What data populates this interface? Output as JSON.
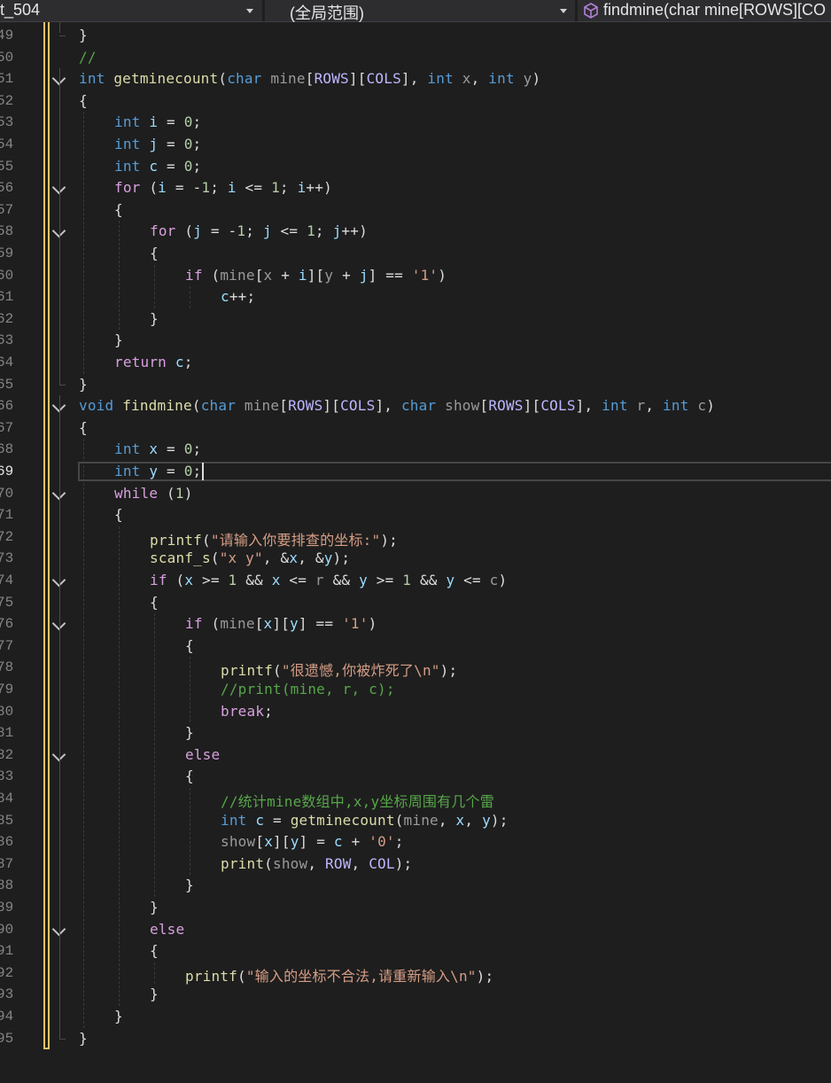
{
  "navbar": {
    "project": "t_504",
    "scope": "(全局范围)",
    "member": "findmine(char mine[ROWS][CO"
  },
  "colors": {
    "background": "#1e1e1e",
    "keyword": "#569cd6",
    "control": "#d8a0df",
    "function": "#dcdcaa",
    "string": "#d69d85",
    "comment": "#57a64a",
    "macro": "#beb7ff",
    "number": "#b5cea8",
    "parameter": "#9a9a9a",
    "local": "#9cdcfe",
    "change_bar": "#e5c365"
  },
  "editor": {
    "current_line": 69,
    "lines": [
      {
        "n": "49",
        "fold": false,
        "indent": 0,
        "tokens": [
          [
            "plain",
            "}"
          ]
        ]
      },
      {
        "n": "50",
        "fold": false,
        "indent": 0,
        "tokens": [
          [
            "cmt",
            "//"
          ]
        ]
      },
      {
        "n": "51",
        "fold": true,
        "indent": 0,
        "tokens": [
          [
            "kw",
            "int"
          ],
          [
            "plain",
            " "
          ],
          [
            "fn",
            "getminecount"
          ],
          [
            "plain",
            "("
          ],
          [
            "kw",
            "char"
          ],
          [
            "plain",
            " "
          ],
          [
            "prm",
            "mine"
          ],
          [
            "plain",
            "["
          ],
          [
            "mac",
            "ROWS"
          ],
          [
            "plain",
            "]["
          ],
          [
            "mac",
            "COLS"
          ],
          [
            "plain",
            "], "
          ],
          [
            "kw",
            "int"
          ],
          [
            "plain",
            " "
          ],
          [
            "prm",
            "x"
          ],
          [
            "plain",
            ", "
          ],
          [
            "kw",
            "int"
          ],
          [
            "plain",
            " "
          ],
          [
            "prm",
            "y"
          ],
          [
            "plain",
            ")"
          ]
        ]
      },
      {
        "n": "52",
        "fold": false,
        "indent": 0,
        "tokens": [
          [
            "plain",
            "{"
          ]
        ]
      },
      {
        "n": "53",
        "fold": false,
        "indent": 1,
        "tokens": [
          [
            "kw",
            "int"
          ],
          [
            "plain",
            " "
          ],
          [
            "var",
            "i"
          ],
          [
            "plain",
            " = "
          ],
          [
            "num",
            "0"
          ],
          [
            "plain",
            ";"
          ]
        ]
      },
      {
        "n": "54",
        "fold": false,
        "indent": 1,
        "tokens": [
          [
            "kw",
            "int"
          ],
          [
            "plain",
            " "
          ],
          [
            "var",
            "j"
          ],
          [
            "plain",
            " = "
          ],
          [
            "num",
            "0"
          ],
          [
            "plain",
            ";"
          ]
        ]
      },
      {
        "n": "55",
        "fold": false,
        "indent": 1,
        "tokens": [
          [
            "kw",
            "int"
          ],
          [
            "plain",
            " "
          ],
          [
            "var",
            "c"
          ],
          [
            "plain",
            " = "
          ],
          [
            "num",
            "0"
          ],
          [
            "plain",
            ";"
          ]
        ]
      },
      {
        "n": "56",
        "fold": true,
        "indent": 1,
        "tokens": [
          [
            "ctl",
            "for"
          ],
          [
            "plain",
            " ("
          ],
          [
            "var",
            "i"
          ],
          [
            "plain",
            " = -"
          ],
          [
            "num",
            "1"
          ],
          [
            "plain",
            "; "
          ],
          [
            "var",
            "i"
          ],
          [
            "plain",
            " <= "
          ],
          [
            "num",
            "1"
          ],
          [
            "plain",
            "; "
          ],
          [
            "var",
            "i"
          ],
          [
            "plain",
            "++)"
          ]
        ]
      },
      {
        "n": "57",
        "fold": false,
        "indent": 1,
        "tokens": [
          [
            "plain",
            "{"
          ]
        ]
      },
      {
        "n": "58",
        "fold": true,
        "indent": 2,
        "tokens": [
          [
            "ctl",
            "for"
          ],
          [
            "plain",
            " ("
          ],
          [
            "var",
            "j"
          ],
          [
            "plain",
            " = -"
          ],
          [
            "num",
            "1"
          ],
          [
            "plain",
            "; "
          ],
          [
            "var",
            "j"
          ],
          [
            "plain",
            " <= "
          ],
          [
            "num",
            "1"
          ],
          [
            "plain",
            "; "
          ],
          [
            "var",
            "j"
          ],
          [
            "plain",
            "++)"
          ]
        ]
      },
      {
        "n": "59",
        "fold": false,
        "indent": 2,
        "tokens": [
          [
            "plain",
            "{"
          ]
        ]
      },
      {
        "n": "60",
        "fold": false,
        "indent": 3,
        "tokens": [
          [
            "ctl",
            "if"
          ],
          [
            "plain",
            " ("
          ],
          [
            "prm",
            "mine"
          ],
          [
            "plain",
            "["
          ],
          [
            "prm",
            "x"
          ],
          [
            "plain",
            " + "
          ],
          [
            "var",
            "i"
          ],
          [
            "plain",
            "]["
          ],
          [
            "prm",
            "y"
          ],
          [
            "plain",
            " + "
          ],
          [
            "var",
            "j"
          ],
          [
            "plain",
            "] == "
          ],
          [
            "str",
            "'1'"
          ],
          [
            "plain",
            ")"
          ]
        ]
      },
      {
        "n": "61",
        "fold": false,
        "indent": 4,
        "tokens": [
          [
            "var",
            "c"
          ],
          [
            "plain",
            "++;"
          ]
        ]
      },
      {
        "n": "62",
        "fold": false,
        "indent": 2,
        "tokens": [
          [
            "plain",
            "}"
          ]
        ]
      },
      {
        "n": "63",
        "fold": false,
        "indent": 1,
        "tokens": [
          [
            "plain",
            "}"
          ]
        ]
      },
      {
        "n": "64",
        "fold": false,
        "indent": 1,
        "tokens": [
          [
            "ctl",
            "return"
          ],
          [
            "plain",
            " "
          ],
          [
            "var",
            "c"
          ],
          [
            "plain",
            ";"
          ]
        ]
      },
      {
        "n": "65",
        "fold": false,
        "indent": 0,
        "tokens": [
          [
            "plain",
            "}"
          ]
        ]
      },
      {
        "n": "66",
        "fold": true,
        "indent": 0,
        "tokens": [
          [
            "kw",
            "void"
          ],
          [
            "plain",
            " "
          ],
          [
            "fn",
            "findmine"
          ],
          [
            "plain",
            "("
          ],
          [
            "kw",
            "char"
          ],
          [
            "plain",
            " "
          ],
          [
            "prm",
            "mine"
          ],
          [
            "plain",
            "["
          ],
          [
            "mac",
            "ROWS"
          ],
          [
            "plain",
            "]["
          ],
          [
            "mac",
            "COLS"
          ],
          [
            "plain",
            "], "
          ],
          [
            "kw",
            "char"
          ],
          [
            "plain",
            " "
          ],
          [
            "prm",
            "show"
          ],
          [
            "plain",
            "["
          ],
          [
            "mac",
            "ROWS"
          ],
          [
            "plain",
            "]["
          ],
          [
            "mac",
            "COLS"
          ],
          [
            "plain",
            "], "
          ],
          [
            "kw",
            "int"
          ],
          [
            "plain",
            " "
          ],
          [
            "prm",
            "r"
          ],
          [
            "plain",
            ", "
          ],
          [
            "kw",
            "int"
          ],
          [
            "plain",
            " "
          ],
          [
            "prm",
            "c"
          ],
          [
            "plain",
            ")"
          ]
        ]
      },
      {
        "n": "67",
        "fold": false,
        "indent": 0,
        "tokens": [
          [
            "plain",
            "{"
          ]
        ]
      },
      {
        "n": "68",
        "fold": false,
        "indent": 1,
        "tokens": [
          [
            "kw",
            "int"
          ],
          [
            "plain",
            " "
          ],
          [
            "var",
            "x"
          ],
          [
            "plain",
            " = "
          ],
          [
            "num",
            "0"
          ],
          [
            "plain",
            ";"
          ]
        ]
      },
      {
        "n": "69",
        "fold": false,
        "indent": 1,
        "tokens": [
          [
            "kw",
            "int"
          ],
          [
            "plain",
            " "
          ],
          [
            "var",
            "y"
          ],
          [
            "plain",
            " = "
          ],
          [
            "num",
            "0"
          ],
          [
            "plain",
            ";"
          ]
        ]
      },
      {
        "n": "70",
        "fold": true,
        "indent": 1,
        "tokens": [
          [
            "ctl",
            "while"
          ],
          [
            "plain",
            " ("
          ],
          [
            "num",
            "1"
          ],
          [
            "plain",
            ")"
          ]
        ]
      },
      {
        "n": "71",
        "fold": false,
        "indent": 1,
        "tokens": [
          [
            "plain",
            "{"
          ]
        ]
      },
      {
        "n": "72",
        "fold": false,
        "indent": 2,
        "tokens": [
          [
            "fn",
            "printf"
          ],
          [
            "plain",
            "("
          ],
          [
            "str",
            "\"请输入你要排查的坐标:\""
          ],
          [
            "plain",
            ");"
          ]
        ]
      },
      {
        "n": "73",
        "fold": false,
        "indent": 2,
        "tokens": [
          [
            "fn",
            "scanf_s"
          ],
          [
            "plain",
            "("
          ],
          [
            "str",
            "\"x y\""
          ],
          [
            "plain",
            ", &"
          ],
          [
            "var",
            "x"
          ],
          [
            "plain",
            ", &"
          ],
          [
            "var",
            "y"
          ],
          [
            "plain",
            ");"
          ]
        ]
      },
      {
        "n": "74",
        "fold": true,
        "indent": 2,
        "tokens": [
          [
            "ctl",
            "if"
          ],
          [
            "plain",
            " ("
          ],
          [
            "var",
            "x"
          ],
          [
            "plain",
            " >= "
          ],
          [
            "num",
            "1"
          ],
          [
            "plain",
            " && "
          ],
          [
            "var",
            "x"
          ],
          [
            "plain",
            " <= "
          ],
          [
            "prm",
            "r"
          ],
          [
            "plain",
            " && "
          ],
          [
            "var",
            "y"
          ],
          [
            "plain",
            " >= "
          ],
          [
            "num",
            "1"
          ],
          [
            "plain",
            " && "
          ],
          [
            "var",
            "y"
          ],
          [
            "plain",
            " <= "
          ],
          [
            "prm",
            "c"
          ],
          [
            "plain",
            ")"
          ]
        ]
      },
      {
        "n": "75",
        "fold": false,
        "indent": 2,
        "tokens": [
          [
            "plain",
            "{"
          ]
        ]
      },
      {
        "n": "76",
        "fold": true,
        "indent": 3,
        "tokens": [
          [
            "ctl",
            "if"
          ],
          [
            "plain",
            " ("
          ],
          [
            "prm",
            "mine"
          ],
          [
            "plain",
            "["
          ],
          [
            "var",
            "x"
          ],
          [
            "plain",
            "]["
          ],
          [
            "var",
            "y"
          ],
          [
            "plain",
            "] == "
          ],
          [
            "str",
            "'1'"
          ],
          [
            "plain",
            ")"
          ]
        ]
      },
      {
        "n": "77",
        "fold": false,
        "indent": 3,
        "tokens": [
          [
            "plain",
            "{"
          ]
        ]
      },
      {
        "n": "78",
        "fold": false,
        "indent": 4,
        "tokens": [
          [
            "fn",
            "printf"
          ],
          [
            "plain",
            "("
          ],
          [
            "str",
            "\"很遗憾,你被炸死了\\n\""
          ],
          [
            "plain",
            ");"
          ]
        ]
      },
      {
        "n": "79",
        "fold": false,
        "indent": 4,
        "tokens": [
          [
            "cmt",
            "//print(mine, r, c);"
          ]
        ]
      },
      {
        "n": "80",
        "fold": false,
        "indent": 4,
        "tokens": [
          [
            "ctl",
            "break"
          ],
          [
            "plain",
            ";"
          ]
        ]
      },
      {
        "n": "81",
        "fold": false,
        "indent": 3,
        "tokens": [
          [
            "plain",
            "}"
          ]
        ]
      },
      {
        "n": "82",
        "fold": true,
        "indent": 3,
        "tokens": [
          [
            "ctl",
            "else"
          ]
        ]
      },
      {
        "n": "83",
        "fold": false,
        "indent": 3,
        "tokens": [
          [
            "plain",
            "{"
          ]
        ]
      },
      {
        "n": "84",
        "fold": false,
        "indent": 4,
        "tokens": [
          [
            "cmt",
            "//统计mine数组中,x,y坐标周围有几个雷"
          ]
        ]
      },
      {
        "n": "85",
        "fold": false,
        "indent": 4,
        "tokens": [
          [
            "kw",
            "int"
          ],
          [
            "plain",
            " "
          ],
          [
            "var",
            "c"
          ],
          [
            "plain",
            " = "
          ],
          [
            "fn",
            "getminecount"
          ],
          [
            "plain",
            "("
          ],
          [
            "prm",
            "mine"
          ],
          [
            "plain",
            ", "
          ],
          [
            "var",
            "x"
          ],
          [
            "plain",
            ", "
          ],
          [
            "var",
            "y"
          ],
          [
            "plain",
            ");"
          ]
        ]
      },
      {
        "n": "86",
        "fold": false,
        "indent": 4,
        "tokens": [
          [
            "prm",
            "show"
          ],
          [
            "plain",
            "["
          ],
          [
            "var",
            "x"
          ],
          [
            "plain",
            "]["
          ],
          [
            "var",
            "y"
          ],
          [
            "plain",
            "] = "
          ],
          [
            "var",
            "c"
          ],
          [
            "plain",
            " + "
          ],
          [
            "str",
            "'0'"
          ],
          [
            "plain",
            ";"
          ]
        ]
      },
      {
        "n": "87",
        "fold": false,
        "indent": 4,
        "tokens": [
          [
            "fn",
            "print"
          ],
          [
            "plain",
            "("
          ],
          [
            "prm",
            "show"
          ],
          [
            "plain",
            ", "
          ],
          [
            "mac",
            "ROW"
          ],
          [
            "plain",
            ", "
          ],
          [
            "mac",
            "COL"
          ],
          [
            "plain",
            ");"
          ]
        ]
      },
      {
        "n": "88",
        "fold": false,
        "indent": 3,
        "tokens": [
          [
            "plain",
            "}"
          ]
        ]
      },
      {
        "n": "89",
        "fold": false,
        "indent": 2,
        "tokens": [
          [
            "plain",
            "}"
          ]
        ]
      },
      {
        "n": "90",
        "fold": true,
        "indent": 2,
        "tokens": [
          [
            "ctl",
            "else"
          ]
        ]
      },
      {
        "n": "91",
        "fold": false,
        "indent": 2,
        "tokens": [
          [
            "plain",
            "{"
          ]
        ]
      },
      {
        "n": "92",
        "fold": false,
        "indent": 3,
        "tokens": [
          [
            "fn",
            "printf"
          ],
          [
            "plain",
            "("
          ],
          [
            "str",
            "\"输入的坐标不合法,请重新输入\\n\""
          ],
          [
            "plain",
            ");"
          ]
        ]
      },
      {
        "n": "93",
        "fold": false,
        "indent": 2,
        "tokens": [
          [
            "plain",
            "}"
          ]
        ]
      },
      {
        "n": "94",
        "fold": false,
        "indent": 1,
        "tokens": [
          [
            "plain",
            "}"
          ]
        ]
      },
      {
        "n": "95",
        "fold": false,
        "indent": 0,
        "tokens": [
          [
            "plain",
            "}"
          ]
        ]
      }
    ]
  }
}
